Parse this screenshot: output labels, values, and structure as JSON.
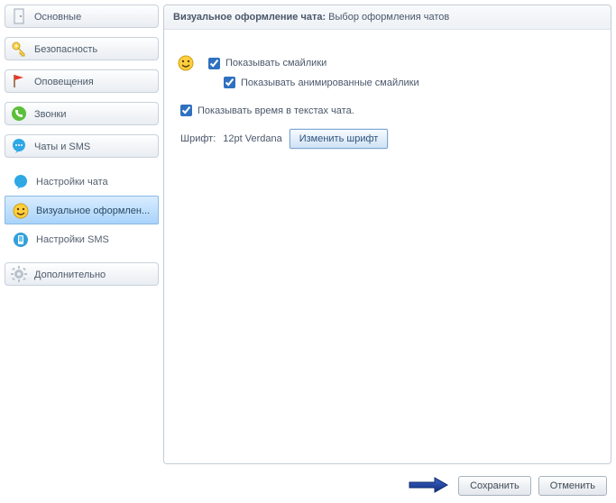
{
  "sidebar": {
    "items": [
      {
        "label": "Основные"
      },
      {
        "label": "Безопасность"
      },
      {
        "label": "Оповещения"
      },
      {
        "label": "Звонки"
      },
      {
        "label": "Чаты и SMS"
      },
      {
        "label": "Настройки чата"
      },
      {
        "label": "Визуальное оформлен..."
      },
      {
        "label": "Настройки SMS"
      },
      {
        "label": "Дополнительно"
      }
    ]
  },
  "header": {
    "title_bold": "Визуальное оформление чата:",
    "title_rest": " Выбор оформления чатов"
  },
  "options": {
    "show_smilies": "Показывать смайлики",
    "show_animated_smilies": "Показывать анимированные смайлики",
    "show_time_in_chat": "Показывать время в текстах чата."
  },
  "font": {
    "label": "Шрифт:",
    "value": "12pt Verdana",
    "change_button": "Изменить шрифт"
  },
  "footer": {
    "save": "Сохранить",
    "cancel": "Отменить"
  }
}
